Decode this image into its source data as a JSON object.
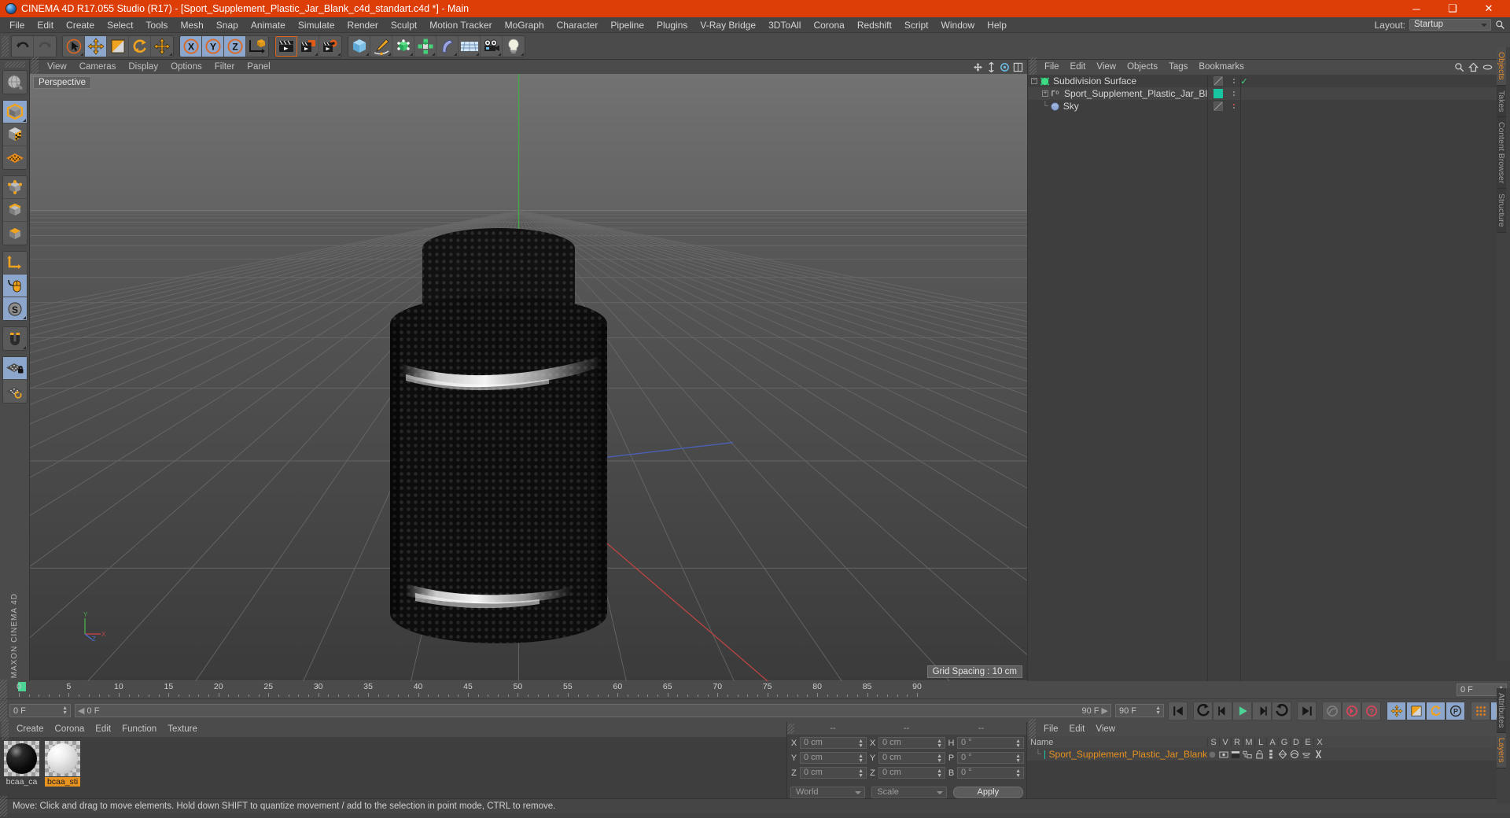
{
  "titlebar": {
    "title": "CINEMA 4D R17.055 Studio (R17) - [Sport_Supplement_Plastic_Jar_Blank_c4d_standart.c4d *] - Main",
    "minimize": "─",
    "maximize": "❑",
    "close": "✕",
    "accent_color": "#dd3d07"
  },
  "menubar": {
    "items": [
      "File",
      "Edit",
      "Create",
      "Select",
      "Tools",
      "Mesh",
      "Snap",
      "Animate",
      "Simulate",
      "Render",
      "Sculpt",
      "Motion Tracker",
      "MoGraph",
      "Character",
      "Pipeline",
      "Plugins",
      "V-Ray Bridge",
      "3DToAll",
      "Corona",
      "Redshift",
      "Script",
      "Window",
      "Help"
    ],
    "layout_label": "Layout:",
    "layout_value": "Startup",
    "search_icon": "magnifier-icon"
  },
  "toolbar": {
    "groups": [
      {
        "name": "undo-redo",
        "buttons": [
          {
            "name": "undo-button",
            "icon": "undo-arrow-icon",
            "active": false
          },
          {
            "name": "redo-button",
            "icon": "redo-arrow-icon",
            "active": false,
            "disabled": true
          }
        ]
      },
      {
        "name": "transform-tools",
        "buttons": [
          {
            "name": "live-selection-tool",
            "icon": "cursor-circle-icon",
            "active": false
          },
          {
            "name": "move-tool",
            "icon": "move-arrows-icon",
            "active": true
          },
          {
            "name": "scale-tool",
            "icon": "scale-box-icon",
            "active": false
          },
          {
            "name": "rotate-tool",
            "icon": "rotate-arrows-icon",
            "active": false
          },
          {
            "name": "free-move-tool",
            "icon": "move-arrows-icon",
            "active": false
          }
        ]
      },
      {
        "name": "axis-locks",
        "buttons": [
          {
            "name": "lock-x-axis",
            "icon": "x-axis-icon",
            "active": true,
            "label": "X"
          },
          {
            "name": "lock-y-axis",
            "icon": "y-axis-icon",
            "active": true,
            "label": "Y"
          },
          {
            "name": "lock-z-axis",
            "icon": "z-axis-icon",
            "active": true,
            "label": "Z"
          },
          {
            "name": "world-object-coordinates",
            "icon": "axis-cube-icon",
            "active": false
          }
        ]
      },
      {
        "name": "render-tools",
        "buttons": [
          {
            "name": "render-view-button",
            "icon": "clapboard-icon",
            "active": false
          },
          {
            "name": "render-to-picture-viewer-button",
            "icon": "clapboard-picture-icon",
            "active": false
          },
          {
            "name": "render-settings-button",
            "icon": "clapboard-gear-icon",
            "active": false
          }
        ]
      },
      {
        "name": "object-creation",
        "buttons": [
          {
            "name": "add-cube-button",
            "icon": "cube-icon",
            "active": false
          },
          {
            "name": "add-spline-button",
            "icon": "pen-spline-icon",
            "active": false
          },
          {
            "name": "add-nurbs-button",
            "icon": "green-nurbs-icon",
            "active": false
          },
          {
            "name": "add-mograph-button",
            "icon": "green-cloner-icon",
            "active": false
          },
          {
            "name": "add-deformer-button",
            "icon": "bend-deformer-icon",
            "active": false
          },
          {
            "name": "add-environment-button",
            "icon": "floor-grid-icon",
            "active": false
          },
          {
            "name": "add-camera-button",
            "icon": "camera-icon",
            "active": false
          },
          {
            "name": "add-light-button",
            "icon": "lightbulb-icon",
            "active": false
          }
        ]
      }
    ]
  },
  "lefttools": {
    "groups": [
      {
        "buttons": [
          {
            "name": "undo-view-button",
            "icon": "globe-sphere-icon",
            "active": false
          }
        ]
      },
      {
        "buttons": [
          {
            "name": "model-mode-button",
            "icon": "model-cube-icon",
            "active": true
          },
          {
            "name": "texture-mode-button",
            "icon": "texture-cube-icon",
            "active": false
          },
          {
            "name": "workplane-mode-button",
            "icon": "workplane-grid-icon",
            "active": false
          }
        ]
      },
      {
        "buttons": [
          {
            "name": "point-mode-button",
            "icon": "point-cube-icon",
            "active": false
          },
          {
            "name": "edge-mode-button",
            "icon": "edge-cube-icon",
            "active": false
          },
          {
            "name": "polygon-mode-button",
            "icon": "polygon-cube-icon",
            "active": false
          }
        ]
      },
      {
        "buttons": [
          {
            "name": "object-axis-mode-button",
            "icon": "axis-corner-icon",
            "active": false
          },
          {
            "name": "viewport-solo-button",
            "icon": "mouse-icon",
            "active": true
          },
          {
            "name": "enable-snapping-button",
            "icon": "s-circle-icon",
            "active": true
          }
        ]
      },
      {
        "buttons": [
          {
            "name": "snap-magnet-button",
            "icon": "magnet-icon",
            "active": false
          }
        ]
      },
      {
        "buttons": [
          {
            "name": "workplane-lock-button",
            "icon": "grid-lock-icon",
            "active": true
          },
          {
            "name": "workplane-reset-button",
            "icon": "grid-reset-icon",
            "active": false
          }
        ]
      }
    ],
    "logo_line1": "MAXON",
    "logo_line2": "CINEMA 4D"
  },
  "viewport": {
    "menu": [
      "View",
      "Cameras",
      "Display",
      "Options",
      "Filter",
      "Panel"
    ],
    "label": "Perspective",
    "grid_spacing": "Grid Spacing : 10 cm",
    "axis_labels": {
      "y": "Y",
      "x": "X",
      "z": "Z"
    },
    "icons": [
      "move-view-icon",
      "scale-view-icon",
      "rotate-view-icon",
      "maximize-view-icon"
    ]
  },
  "object_manager": {
    "menu": [
      "File",
      "Edit",
      "View",
      "Objects",
      "Tags",
      "Bookmarks"
    ],
    "header_icons": [
      "search-icon",
      "home-icon",
      "eye-icon",
      "new-layer-icon"
    ],
    "rows": [
      {
        "name": "Subdivision Surface",
        "depth": 0,
        "icon": "subdivision-surface-icon",
        "icon_color": "#3ddc84",
        "expander": "minus",
        "tag": "blank-tag",
        "check": true,
        "selected": false
      },
      {
        "name": "Sport_Supplement_Plastic_Jar_Blank",
        "depth": 1,
        "icon": "polygon-object-icon",
        "icon_color": "#cfcfcf",
        "expander": "plus",
        "tag": "green-material-tag",
        "tag_color": "#17c6a0",
        "check": false,
        "selected": true
      },
      {
        "name": "Sky",
        "depth": 1,
        "icon": "sky-object-icon",
        "icon_color": "#8fa8d6",
        "expander": "none",
        "tag": "blank-tag",
        "reddot": true,
        "selected": false
      }
    ],
    "side_tabs": [
      {
        "label": "Objects",
        "active": true
      },
      {
        "label": "Takes",
        "active": false
      },
      {
        "label": "Content Browser",
        "active": false
      },
      {
        "label": "Structure",
        "active": false
      }
    ]
  },
  "timeline": {
    "ticks": [
      0,
      5,
      10,
      15,
      20,
      25,
      30,
      35,
      40,
      45,
      50,
      55,
      60,
      65,
      70,
      75,
      80,
      85,
      90
    ],
    "min_frame": 0,
    "max_frame": 90,
    "current_frame_field": "0 F",
    "current_frame_right": "0 F",
    "range_start": "0 F",
    "range_end": "90 F",
    "preview_end": "90 F",
    "playhead_frame": 0
  },
  "transport": {
    "buttons": [
      {
        "name": "go-to-start-button",
        "icon": "skip-start-icon",
        "active": false
      },
      {
        "name": "previous-key-button",
        "icon": "prev-key-icon",
        "active": false
      },
      {
        "name": "previous-frame-button",
        "icon": "step-back-icon",
        "active": false
      },
      {
        "name": "play-button",
        "icon": "play-icon",
        "active": false
      },
      {
        "name": "next-frame-button",
        "icon": "step-forward-icon",
        "active": false
      },
      {
        "name": "next-key-button",
        "icon": "next-key-icon",
        "active": false
      },
      {
        "name": "go-to-end-button",
        "icon": "skip-end-icon",
        "active": false
      },
      {
        "name": "record-active-objects-button",
        "icon": "record-icon",
        "active": false
      },
      {
        "name": "autokeying-button",
        "icon": "autokey-icon",
        "active": false
      },
      {
        "name": "keyframe-selection-button",
        "icon": "question-icon",
        "active": false
      },
      {
        "name": "position-key-button",
        "icon": "move-arrows-icon",
        "active": true
      },
      {
        "name": "scale-key-button",
        "icon": "scale-box-icon",
        "active": true
      },
      {
        "name": "rotation-key-button",
        "icon": "rotate-arrows-icon",
        "active": true
      },
      {
        "name": "parameter-key-button",
        "icon": "p-circle-icon",
        "active": true
      },
      {
        "name": "point-level-animation-button",
        "icon": "pla-dots-icon",
        "active": false
      },
      {
        "name": "timeline-window-button",
        "icon": "film-strip-icon",
        "active": true
      }
    ]
  },
  "material_manager": {
    "menu": [
      "Create",
      "Corona",
      "Edit",
      "Function",
      "Texture"
    ],
    "materials": [
      {
        "name": "bcaa_ca",
        "color": "#141414",
        "selected": false
      },
      {
        "name": "bcaa_sti",
        "color": "#e4e4e4",
        "selected": true
      }
    ]
  },
  "coordinate_manager": {
    "headers": [
      "--",
      "--",
      "--"
    ],
    "rows": [
      {
        "label1": "X",
        "value1": "0 cm",
        "label2": "X",
        "value2": "0 cm",
        "label3": "H",
        "value3": "0 °"
      },
      {
        "label1": "Y",
        "value1": "0 cm",
        "label2": "Y",
        "value2": "0 cm",
        "label3": "P",
        "value3": "0 °"
      },
      {
        "label1": "Z",
        "value1": "0 cm",
        "label2": "Z",
        "value2": "0 cm",
        "label3": "B",
        "value3": "0 °"
      }
    ],
    "system_dropdown": "World",
    "mode_dropdown": "Scale",
    "apply_label": "Apply"
  },
  "layer_manager": {
    "menu": [
      "File",
      "Edit",
      "View"
    ],
    "columns": [
      "Name",
      "S",
      "V",
      "R",
      "M",
      "L",
      "A",
      "G",
      "D",
      "E",
      "X"
    ],
    "rows": [
      {
        "name": "Sport_Supplement_Plastic_Jar_Blank",
        "swatch": "#17c6a0"
      }
    ],
    "side_tabs": [
      {
        "label": "Attributes",
        "active": false
      },
      {
        "label": "Layers",
        "active": true
      }
    ]
  },
  "statusbar": {
    "text": "Move: Click and drag to move elements. Hold down SHIFT to quantize movement / add to the selection in point mode, CTRL to remove."
  }
}
